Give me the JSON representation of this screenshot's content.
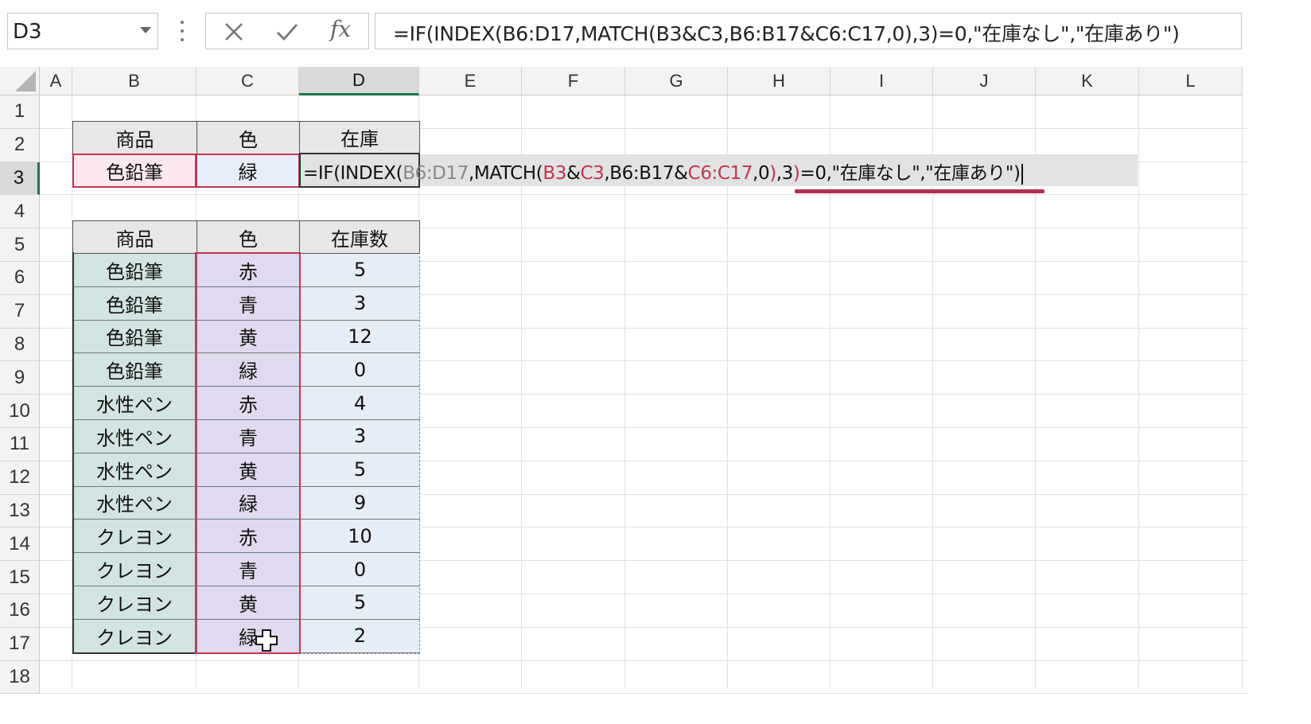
{
  "name_box": {
    "value": "D3"
  },
  "formula_bar": {
    "cancel_icon": "close-x-icon",
    "enter_icon": "check-icon",
    "fx_label": "fx",
    "formula": "=IF(INDEX(B6:D17,MATCH(B3&C3,B6:B17&C6:C17,0),3)=0,\"在庫なし\",\"在庫あり\")"
  },
  "columns": [
    "A",
    "B",
    "C",
    "D",
    "E",
    "F",
    "G",
    "H",
    "I",
    "J",
    "K",
    "L"
  ],
  "rows": [
    "1",
    "2",
    "3",
    "4",
    "5",
    "6",
    "7",
    "8",
    "9",
    "10",
    "11",
    "12",
    "13",
    "14",
    "15",
    "16",
    "17",
    "18"
  ],
  "active_cell": "D3",
  "lookup": {
    "headers": [
      "商品",
      "色",
      "在庫"
    ],
    "product": "色鉛筆",
    "color": "緑",
    "cell_formula": {
      "p1": "=IF(INDEX(",
      "p2": "B6:D17",
      "p3": ",MATCH(",
      "p4": "B3",
      "p5": "&",
      "p6": "C3",
      "p7": ",B6:B17&",
      "p8": "C6:C17",
      "p9": ",0",
      "p10": ")",
      "p11": ",3",
      "p12": ")",
      "p13": "=0,\"在庫なし\",\"在庫あり\")"
    }
  },
  "table": {
    "headers": [
      "商品",
      "色",
      "在庫数"
    ],
    "rows": [
      [
        "色鉛筆",
        "赤",
        "5"
      ],
      [
        "色鉛筆",
        "青",
        "3"
      ],
      [
        "色鉛筆",
        "黄",
        "12"
      ],
      [
        "色鉛筆",
        "緑",
        "0"
      ],
      [
        "水性ペン",
        "赤",
        "4"
      ],
      [
        "水性ペン",
        "青",
        "3"
      ],
      [
        "水性ペン",
        "黄",
        "5"
      ],
      [
        "水性ペン",
        "緑",
        "9"
      ],
      [
        "クレヨン",
        "赤",
        "10"
      ],
      [
        "クレヨン",
        "青",
        "0"
      ],
      [
        "クレヨン",
        "黄",
        "5"
      ],
      [
        "クレヨン",
        "緑",
        "2"
      ]
    ]
  },
  "colors": {
    "accent_green": "#217346",
    "highlight_red": "#c2354f",
    "product_fill": "#d2e4e2",
    "color_fill": "#e1d9ee",
    "stock_fill": "#e6edf6"
  }
}
